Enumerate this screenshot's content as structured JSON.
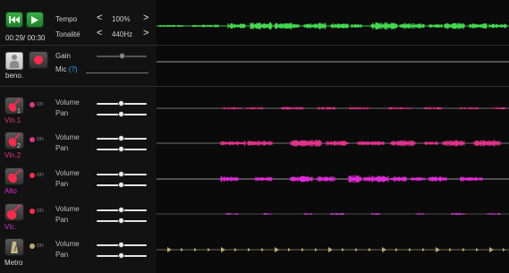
{
  "transport": {
    "time": "00:29/ 00:30",
    "tempo_label": "Tempo",
    "tempo_value": "100%",
    "tonality_label": "Tonalité",
    "tonality_value": "440Hz",
    "prev_arrow": "<",
    "next_arrow": ">"
  },
  "recorder": {
    "user_name": "beno.",
    "gain_label": "Gain",
    "mic_label": "Mic",
    "mic_help": "(?)"
  },
  "tracks": [
    {
      "name": "Vln.1",
      "color": "#e0338a",
      "on_label": "on",
      "volume_label": "Volume",
      "pan_label": "Pan"
    },
    {
      "name": "Vln.2",
      "color": "#e0338a",
      "on_label": "on",
      "volume_label": "Volume",
      "pan_label": "Pan"
    },
    {
      "name": "Alto",
      "color": "#e02bd6",
      "on_label": "on",
      "volume_label": "Volume",
      "pan_label": "Pan"
    },
    {
      "name": "Vlc.",
      "color": "#c03ac4",
      "on_label": "on",
      "volume_label": "Volume",
      "pan_label": "Pan"
    },
    {
      "name": "Metro",
      "color": "#b8a870",
      "on_label": "on",
      "volume_label": "Volume",
      "pan_label": "Pan"
    }
  ],
  "colors": {
    "master_wave": "#43d84f",
    "accent_green": "#2f9c3d",
    "rec_red": "#ff2a4a",
    "help_blue": "#1ea6ff"
  }
}
